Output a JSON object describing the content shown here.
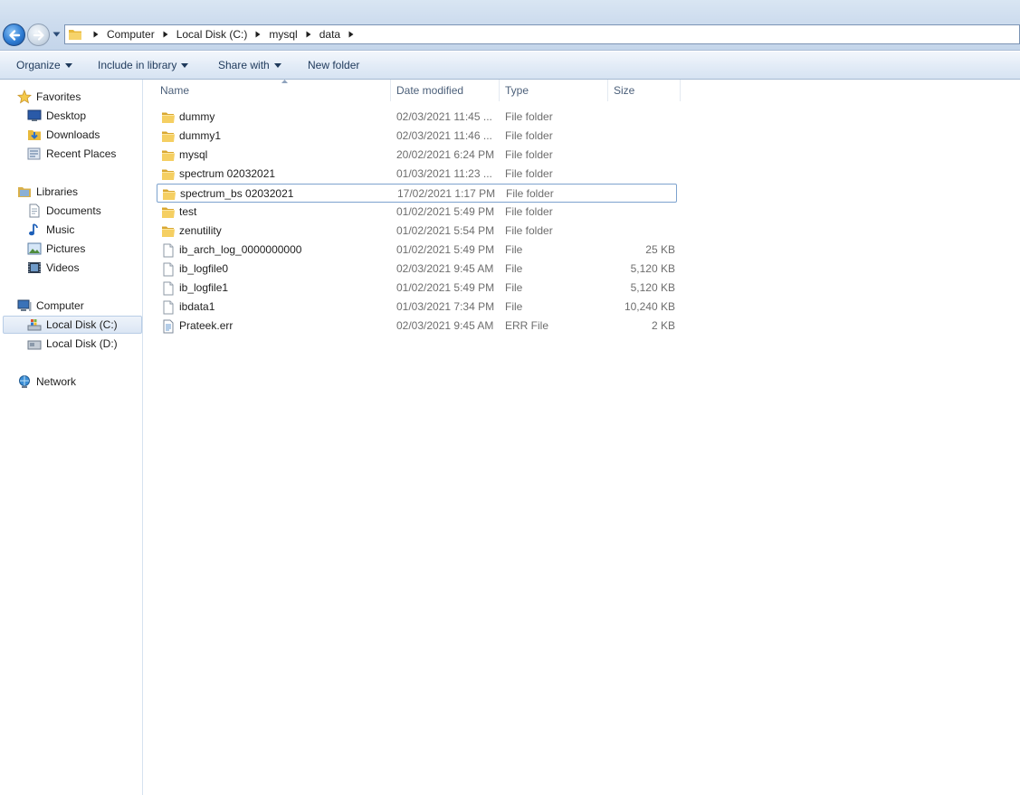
{
  "address_bar": {
    "breadcrumbs": [
      "Computer",
      "Local Disk (C:)",
      "mysql",
      "data"
    ]
  },
  "toolbar": {
    "organize": "Organize",
    "include_in_library": "Include in library",
    "share_with": "Share with",
    "new_folder": "New folder"
  },
  "navigation": {
    "favorites": {
      "label": "Favorites",
      "items": [
        "Desktop",
        "Downloads",
        "Recent Places"
      ]
    },
    "libraries": {
      "label": "Libraries",
      "items": [
        "Documents",
        "Music",
        "Pictures",
        "Videos"
      ]
    },
    "computer": {
      "label": "Computer",
      "items": [
        "Local Disk (C:)",
        "Local Disk (D:)"
      ],
      "selected": "Local Disk (C:)"
    },
    "network": {
      "label": "Network"
    }
  },
  "columns": {
    "name": "Name",
    "date_modified": "Date modified",
    "type": "Type",
    "size": "Size"
  },
  "files": [
    {
      "name": "dummy",
      "date": "02/03/2021 11:45 ...",
      "type": "File folder",
      "size": "",
      "icon": "folder-icon"
    },
    {
      "name": "dummy1",
      "date": "02/03/2021 11:46 ...",
      "type": "File folder",
      "size": "",
      "icon": "folder-icon"
    },
    {
      "name": "mysql",
      "date": "20/02/2021 6:24 PM",
      "type": "File folder",
      "size": "",
      "icon": "folder-icon"
    },
    {
      "name": "spectrum 02032021",
      "date": "01/03/2021 11:23 ...",
      "type": "File folder",
      "size": "",
      "icon": "folder-icon"
    },
    {
      "name": "spectrum_bs 02032021",
      "date": "17/02/2021 1:17 PM",
      "type": "File folder",
      "size": "",
      "icon": "folder-icon",
      "selected": true
    },
    {
      "name": "test",
      "date": "01/02/2021 5:49 PM",
      "type": "File folder",
      "size": "",
      "icon": "folder-icon"
    },
    {
      "name": "zenutility",
      "date": "01/02/2021 5:54 PM",
      "type": "File folder",
      "size": "",
      "icon": "folder-icon"
    },
    {
      "name": "ib_arch_log_0000000000",
      "date": "01/02/2021 5:49 PM",
      "type": "File",
      "size": "25 KB",
      "icon": "file-icon"
    },
    {
      "name": "ib_logfile0",
      "date": "02/03/2021 9:45 AM",
      "type": "File",
      "size": "5,120 KB",
      "icon": "file-icon"
    },
    {
      "name": "ib_logfile1",
      "date": "01/02/2021 5:49 PM",
      "type": "File",
      "size": "5,120 KB",
      "icon": "file-icon"
    },
    {
      "name": "ibdata1",
      "date": "01/03/2021 7:34 PM",
      "type": "File",
      "size": "10,240 KB",
      "icon": "file-icon"
    },
    {
      "name": "Prateek.err",
      "date": "02/03/2021 9:45 AM",
      "type": "ERR File",
      "size": "2 KB",
      "icon": "text-file-icon"
    }
  ]
}
